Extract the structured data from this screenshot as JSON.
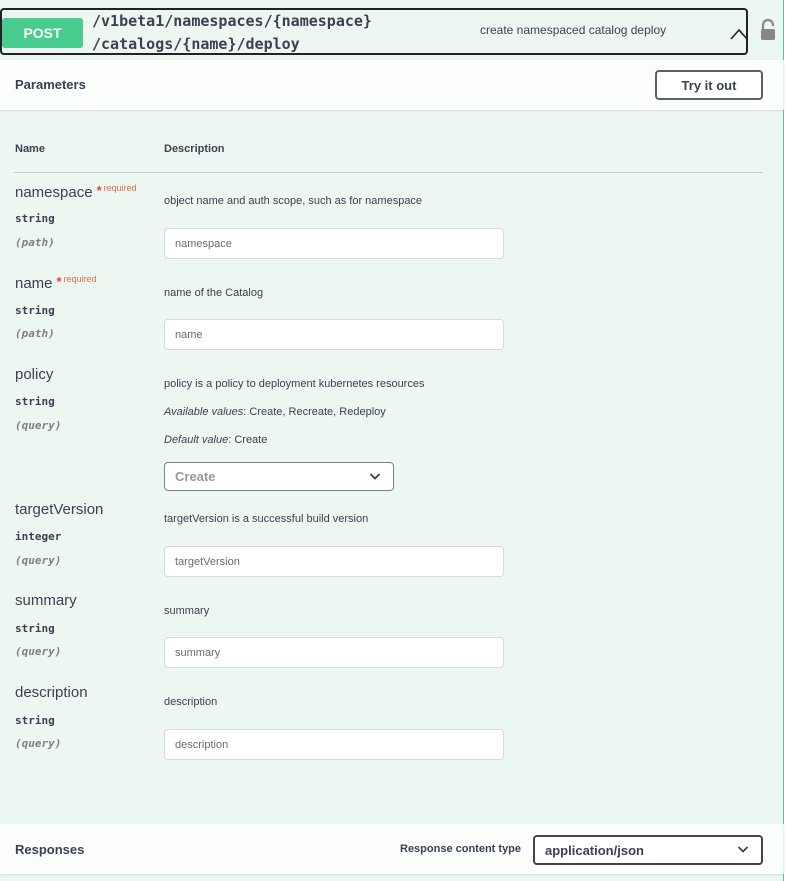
{
  "operation": {
    "method": "POST",
    "path_line1": "/v1beta1/namespaces/{namespace}",
    "path_line2": "/catalogs/{name}/deploy",
    "summary": "create namespaced catalog deploy"
  },
  "parameters_section": {
    "title": "Parameters",
    "try_it_out": "Try it out",
    "col_name": "Name",
    "col_description": "Description"
  },
  "required_label": "required",
  "params": [
    {
      "name": "namespace",
      "type": "string",
      "in": "(path)",
      "description": "object name and auth scope, such as for namespace",
      "placeholder": "namespace",
      "required": true
    },
    {
      "name": "name",
      "type": "string",
      "in": "(path)",
      "description": "name of the Catalog",
      "placeholder": "name",
      "required": true
    },
    {
      "name": "policy",
      "type": "string",
      "in": "(query)",
      "description": "policy is a policy to deployment kubernetes resources",
      "available_label": "Available values",
      "available_values": ": Create, Recreate, Redeploy",
      "default_label": "Default value",
      "default_value": ": Create",
      "selected": "Create"
    },
    {
      "name": "targetVersion",
      "type": "integer",
      "in": "(query)",
      "description": "targetVersion is a successful build version",
      "placeholder": "targetVersion"
    },
    {
      "name": "summary",
      "type": "string",
      "in": "(query)",
      "description": "summary",
      "placeholder": "summary"
    },
    {
      "name": "description",
      "type": "string",
      "in": "(query)",
      "description": "description",
      "placeholder": "description"
    }
  ],
  "responses_section": {
    "title": "Responses",
    "content_type_label": "Response content type",
    "content_type_value": "application/json"
  },
  "colors": {
    "post_green": "#49cc90",
    "block_bg": "#edf7f1",
    "required_red": "#e53e3e"
  }
}
